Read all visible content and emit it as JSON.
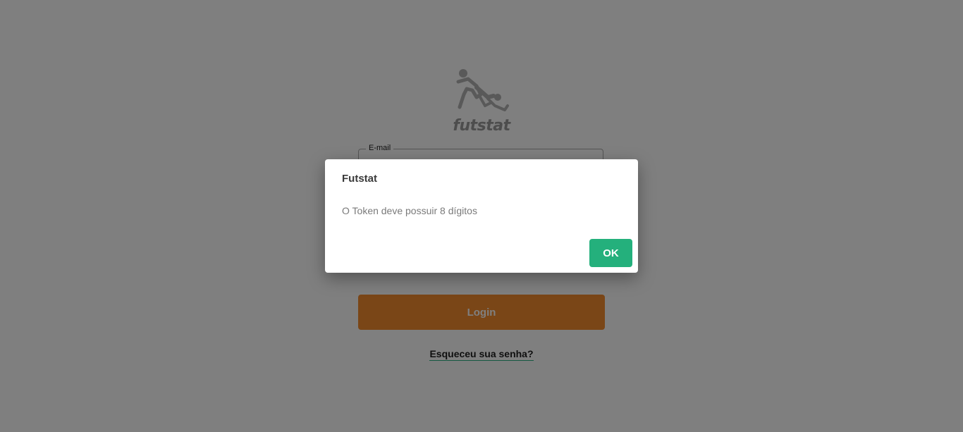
{
  "login": {
    "logo_text": "futstat",
    "email_label": "E-mail",
    "login_button": "Login",
    "forgot_link": "Esqueceu sua senha?"
  },
  "dialog": {
    "title": "Futstat",
    "message": "O Token deve possuir 8 dígitos",
    "ok_button": "OK"
  },
  "colors": {
    "overlay": "rgba(0,0,0,0.5)",
    "login_button": "#f58c2e",
    "ok_button": "#24b07c",
    "link_underline": "#2bb383"
  },
  "icons": {
    "logo": "bicycle-kick-player-logo"
  }
}
